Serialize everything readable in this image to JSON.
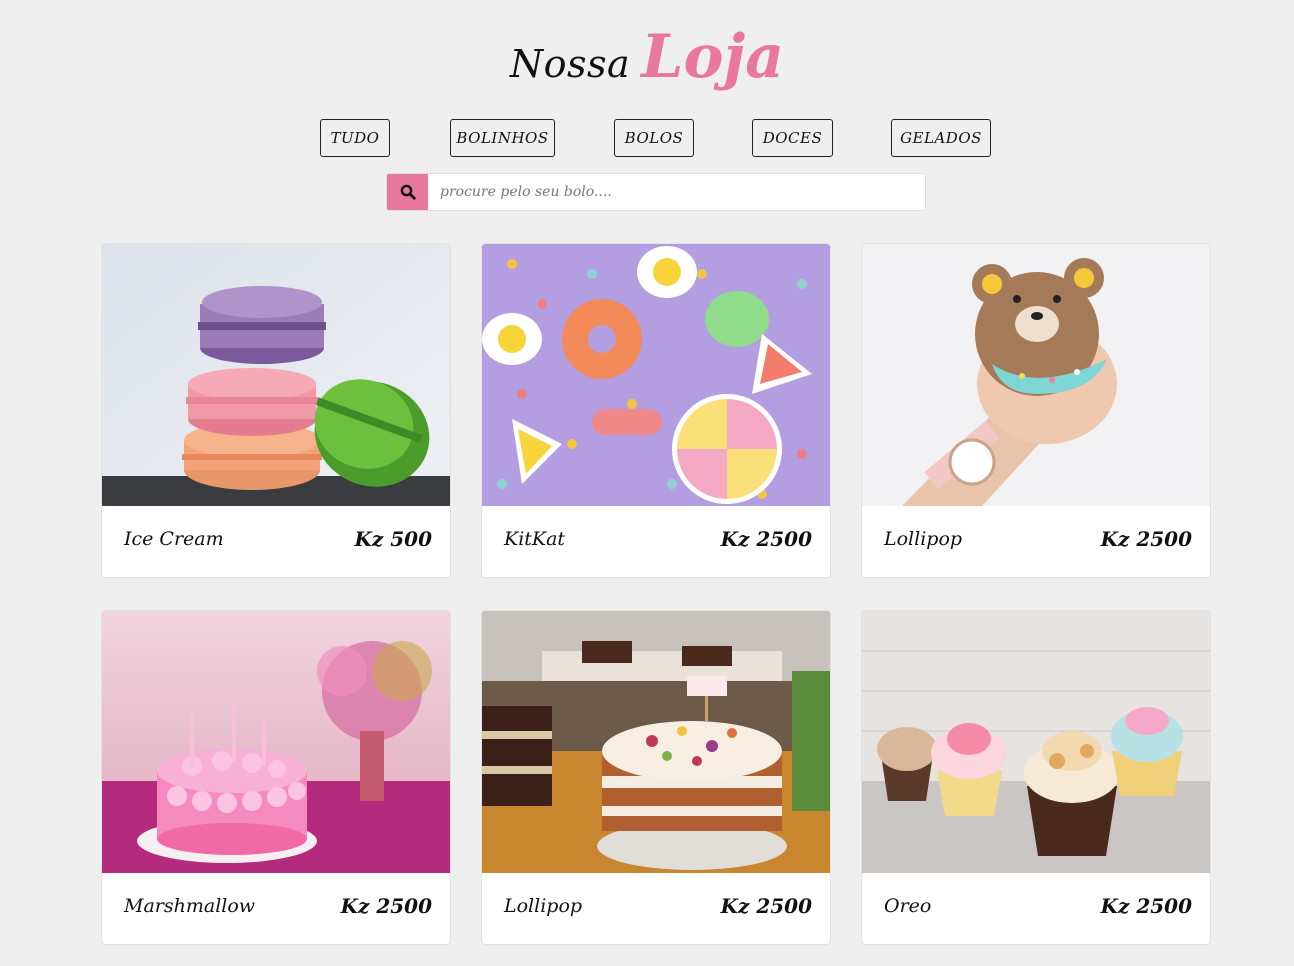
{
  "header": {
    "title_part1": "Nossa",
    "title_part2": "Loja",
    "accent_color": "#e8789e"
  },
  "filters": [
    {
      "label": "TUDO"
    },
    {
      "label": "BOLINHOS"
    },
    {
      "label": "BOLOS"
    },
    {
      "label": "DOCES"
    },
    {
      "label": "GELADOS"
    }
  ],
  "search": {
    "placeholder": "procure pelo seu bolo....",
    "value": "",
    "icon": "search-icon"
  },
  "products": [
    {
      "name": "Ice Cream",
      "price": "Kz 500",
      "image": "macarons"
    },
    {
      "name": "KitKat",
      "price": "Kz 2500",
      "image": "candy-sprinkles"
    },
    {
      "name": "Lollipop",
      "price": "Kz 2500",
      "image": "bear-donut"
    },
    {
      "name": "Marshmallow",
      "price": "Kz 2500",
      "image": "pink-cake"
    },
    {
      "name": "Lollipop",
      "price": "Kz 2500",
      "image": "naked-cake"
    },
    {
      "name": "Oreo",
      "price": "Kz 2500",
      "image": "cupcakes"
    }
  ]
}
